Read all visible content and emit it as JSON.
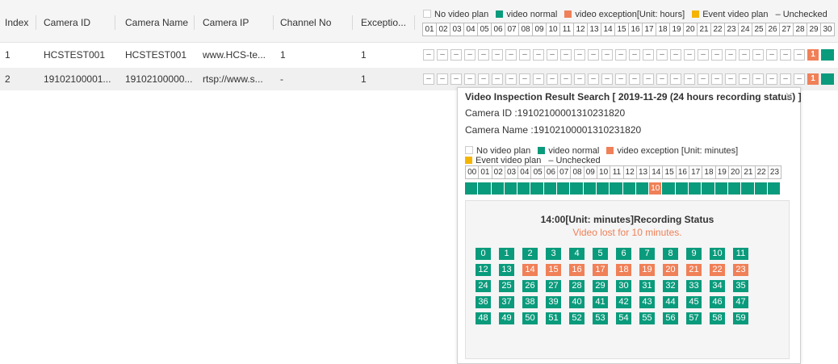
{
  "table": {
    "headers": {
      "index": "Index",
      "camera_id": "Camera ID",
      "camera_name": "Camera Name",
      "camera_ip": "Camera IP",
      "channel_no": "Channel No",
      "exception": "Exceptio..."
    },
    "legend": {
      "no_plan": "No video plan",
      "normal": "video normal",
      "exception": "video exception[Unit: hours]",
      "event": "Event video plan",
      "unchecked_symbol": "–",
      "unchecked": "Unchecked"
    },
    "days": [
      "01",
      "02",
      "03",
      "04",
      "05",
      "06",
      "07",
      "08",
      "09",
      "10",
      "11",
      "12",
      "13",
      "14",
      "15",
      "16",
      "17",
      "18",
      "19",
      "20",
      "21",
      "22",
      "23",
      "24",
      "25",
      "26",
      "27",
      "28",
      "29",
      "30"
    ],
    "rows": [
      {
        "index": "1",
        "camera_id": "HCSTEST001",
        "camera_name": "HCSTEST001",
        "camera_ip": "www.HCS-te...",
        "channel_no": "1",
        "exception": "1",
        "day_cells": [
          "–",
          "–",
          "–",
          "–",
          "–",
          "–",
          "–",
          "–",
          "–",
          "–",
          "–",
          "–",
          "–",
          "–",
          "–",
          "–",
          "–",
          "–",
          "–",
          "–",
          "–",
          "–",
          "–",
          "–",
          "–",
          "–",
          "–",
          "–"
        ],
        "exception_day": "1"
      },
      {
        "index": "2",
        "camera_id": "19102100001...",
        "camera_name": "19102100000...",
        "camera_ip": "rtsp://www.s...",
        "channel_no": "-",
        "exception": "1",
        "day_cells": [
          "–",
          "–",
          "–",
          "–",
          "–",
          "–",
          "–",
          "–",
          "–",
          "–",
          "–",
          "–",
          "–",
          "–",
          "–",
          "–",
          "–",
          "–",
          "–",
          "–",
          "–",
          "–",
          "–",
          "–",
          "–",
          "–",
          "–",
          "–"
        ],
        "exception_day": "1"
      }
    ]
  },
  "popup": {
    "title": "Video Inspection Result Search [ 2019-11-29 (24 hours recording status) ]",
    "close": "X",
    "camera_id_line": "Camera ID :19102100001310231820",
    "camera_name_line": "Camera Name :19102100001310231820",
    "legend": {
      "no_plan": "No video plan",
      "normal": "video normal",
      "exception": "video exception [Unit: minutes]",
      "event": "Event video plan",
      "unchecked_symbol": "–",
      "unchecked": "Unchecked"
    },
    "hours": [
      "00",
      "01",
      "02",
      "03",
      "04",
      "05",
      "06",
      "07",
      "08",
      "09",
      "10",
      "11",
      "12",
      "13",
      "14",
      "15",
      "16",
      "17",
      "18",
      "19",
      "20",
      "21",
      "22",
      "23"
    ],
    "hour_exception_index": 14,
    "hour_exception_value": "10",
    "detail": {
      "title": "14:00[Unit: minutes]Recording Status",
      "message": "Video lost for 10 minutes.",
      "minutes": [
        "0",
        "1",
        "2",
        "3",
        "4",
        "5",
        "6",
        "7",
        "8",
        "9",
        "10",
        "11",
        "12",
        "13",
        "14",
        "15",
        "16",
        "17",
        "18",
        "19",
        "20",
        "21",
        "22",
        "23",
        "24",
        "25",
        "26",
        "27",
        "28",
        "29",
        "30",
        "31",
        "32",
        "33",
        "34",
        "35",
        "36",
        "37",
        "38",
        "39",
        "40",
        "41",
        "42",
        "43",
        "44",
        "45",
        "46",
        "47",
        "48",
        "49",
        "50",
        "51",
        "52",
        "53",
        "54",
        "55",
        "56",
        "57",
        "58",
        "59"
      ],
      "exception_minutes": [
        "14",
        "15",
        "16",
        "17",
        "18",
        "19",
        "20",
        "21",
        "22",
        "23"
      ]
    }
  },
  "colors": {
    "normal": "#0a9b7c",
    "exception": "#f08058",
    "event": "#f5b400"
  }
}
